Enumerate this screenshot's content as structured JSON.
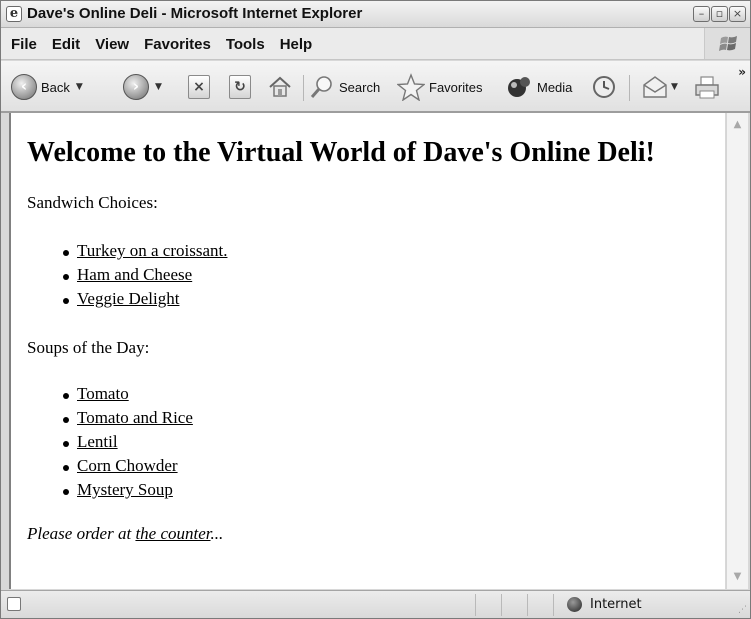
{
  "window": {
    "title": "Dave's Online Deli - Microsoft Internet Explorer"
  },
  "menu": {
    "items": [
      "File",
      "Edit",
      "View",
      "Favorites",
      "Tools",
      "Help"
    ]
  },
  "toolbar": {
    "back_label": "Back",
    "search_label": "Search",
    "favorites_label": "Favorites",
    "media_label": "Media",
    "more_glyph": "»"
  },
  "page": {
    "heading": "Welcome to the Virtual World of Dave's Online Deli!",
    "sandwich_label": "Sandwich Choices:",
    "sandwiches": [
      "Turkey on a croissant.",
      "Ham and Cheese",
      "Veggie Delight"
    ],
    "soups_label": "Soups of the Day:",
    "soups": [
      "Tomato",
      "Tomato and Rice",
      "Lentil",
      "Corn Chowder",
      "Mystery Soup"
    ],
    "order_prefix": "Please order at ",
    "order_link": "the counter",
    "order_suffix": "..."
  },
  "status": {
    "zone": "Internet"
  },
  "colors": {
    "content_bg": "#ffffff",
    "chrome_bg": "#e6e6e6",
    "link": "#000000"
  }
}
